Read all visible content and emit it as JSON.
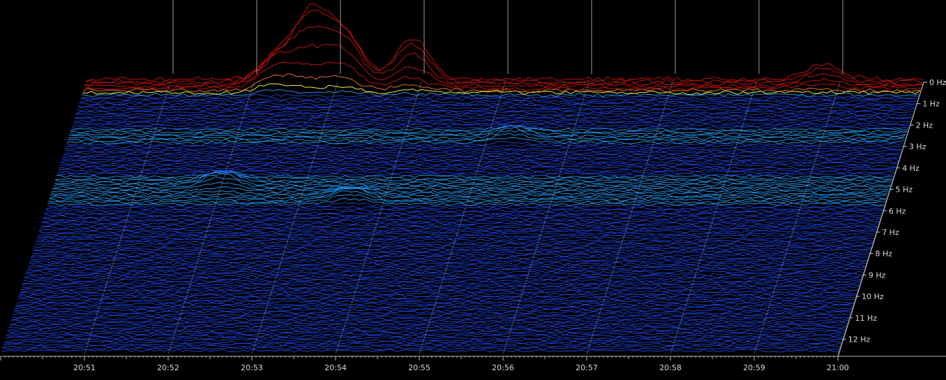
{
  "chart_data": {
    "type": "waterfall-spectrogram",
    "x_axis": {
      "unit": "time",
      "ticks": [
        "20:51",
        "20:52",
        "20:53",
        "20:54",
        "20:55",
        "20:56",
        "20:57",
        "20:58",
        "20:59",
        "21:00"
      ]
    },
    "depth_axis": {
      "unit": "Hz",
      "ticks": [
        "0 Hz",
        "1 Hz",
        "2 Hz",
        "3 Hz",
        "4 Hz",
        "5 Hz",
        "6 Hz",
        "7 Hz",
        "8 Hz",
        "9 Hz",
        "10 Hz",
        "11 Hz",
        "12 Hz"
      ],
      "range": [
        0,
        12.7
      ]
    },
    "colormap": [
      "#0a1a8c",
      "#1a3fd0",
      "#1e8fe8",
      "#2ee0e0",
      "#7cf070",
      "#e8e840",
      "#e07020",
      "#c01010"
    ],
    "peaks": [
      {
        "time": "20:52.7",
        "freq_hz": 0.0,
        "amp": 1.0
      },
      {
        "time": "20:53.1",
        "freq_hz": 0.1,
        "amp": 0.7
      },
      {
        "time": "20:53.9",
        "freq_hz": 0.0,
        "amp": 0.62
      },
      {
        "time": "20:52.3",
        "freq_hz": 0.2,
        "amp": 0.45
      },
      {
        "time": "20:58.8",
        "freq_hz": 0.0,
        "amp": 0.22
      },
      {
        "time": "20:52.0",
        "freq_hz": 4.8,
        "amp": 0.18
      },
      {
        "time": "20:53.6",
        "freq_hz": 5.5,
        "amp": 0.14
      },
      {
        "time": "20:55.3",
        "freq_hz": 2.6,
        "amp": 0.12
      },
      {
        "time": "20:60.3",
        "freq_hz": 2.6,
        "amp": 0.12
      }
    ],
    "grid": true
  }
}
